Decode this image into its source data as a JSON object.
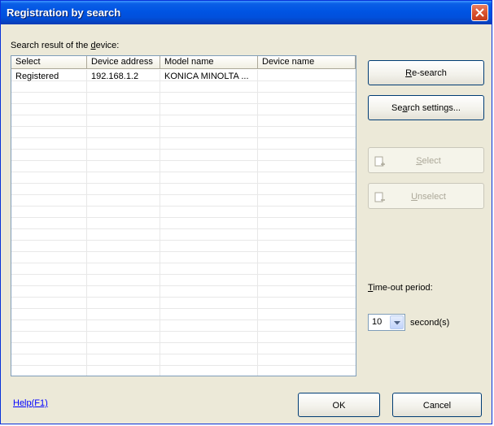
{
  "window": {
    "title": "Registration by search"
  },
  "search_label": {
    "pre": "Search result of the ",
    "accel": "d",
    "post": "evice:"
  },
  "table": {
    "columns": [
      "Select",
      "Device address",
      "Model name",
      "Device name"
    ],
    "rows": [
      {
        "select": "Registered",
        "address": "192.168.1.2",
        "model": "KONICA MINOLTA ...",
        "name": ""
      }
    ]
  },
  "buttons": {
    "research": {
      "accel": "R",
      "rest": "e-search"
    },
    "search_settings": {
      "pre": "Se",
      "accel": "a",
      "post": "rch settings..."
    },
    "select": {
      "accel": "S",
      "rest": "elect"
    },
    "unselect": {
      "accel": "U",
      "rest": "nselect"
    },
    "ok": "OK",
    "cancel": "Cancel"
  },
  "timeout": {
    "label_accel": "T",
    "label_rest": "ime-out period:",
    "value": "10",
    "unit": "second(s)"
  },
  "help": {
    "pre": "Help(",
    "accel": "F",
    "post": "1)"
  }
}
